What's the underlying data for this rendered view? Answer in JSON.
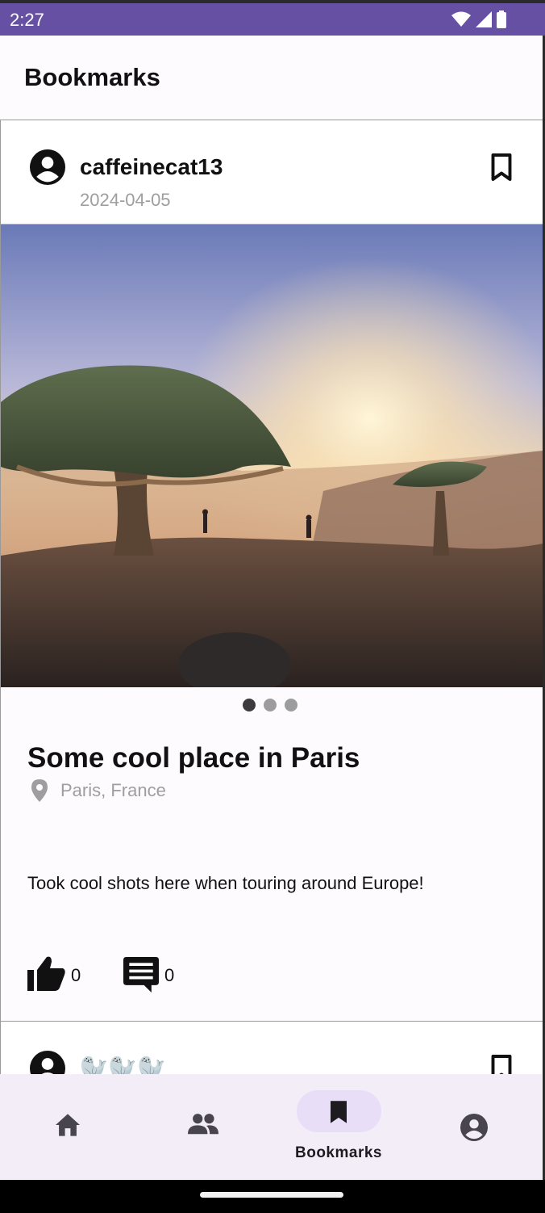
{
  "status_bar": {
    "time": "2:27"
  },
  "app_bar": {
    "title": "Bookmarks"
  },
  "post": {
    "username": "caffeinecat13",
    "date": "2024-04-05",
    "title": "Some cool place in Paris",
    "location": "Paris, France",
    "description": "Took cool shots here when touring around Europe!",
    "likes": "0",
    "comments": "0",
    "image_pages": 3,
    "active_page": 1
  },
  "next_post": {
    "username": "🦭🦭🦭"
  },
  "bottom_nav": {
    "items": [
      {
        "id": "home",
        "icon": "home-icon",
        "label": ""
      },
      {
        "id": "friends",
        "icon": "people-icon",
        "label": ""
      },
      {
        "id": "bookmarks",
        "icon": "bookmark-icon",
        "label": "Bookmarks",
        "selected": true
      },
      {
        "id": "profile",
        "icon": "account-circle-icon",
        "label": ""
      }
    ]
  },
  "colors": {
    "status_bar": "#6650a4",
    "nav_background": "#f3edf7",
    "nav_indicator": "#e8def8",
    "secondary_text": "#9e9e9e"
  }
}
